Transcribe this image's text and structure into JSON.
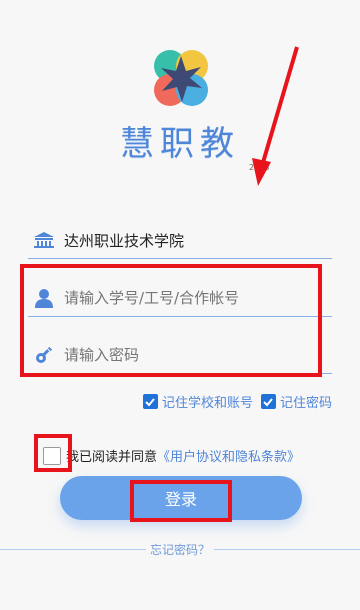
{
  "app": {
    "title": "慧职教",
    "version": "2.0.8"
  },
  "form": {
    "school_name": "达州职业技术学院",
    "username_placeholder": "请输入学号/工号/合作帐号",
    "password_placeholder": "请输入密码"
  },
  "options": {
    "remember_school_label": "记住学校和账号",
    "remember_school_checked": true,
    "remember_password_label": "记住密码",
    "remember_password_checked": true
  },
  "agreement": {
    "text": "我已阅读并同意",
    "link": "《用户协议和隐私条款》",
    "checked": false
  },
  "buttons": {
    "login_label": "登录",
    "forgot_label": "忘记密码？"
  },
  "colors": {
    "accent": "#4f86d8",
    "button": "#6aa3ea",
    "checkbox": "#1e72d8",
    "highlight_red": "#e8141c"
  },
  "icons": {
    "school": "school-building-icon",
    "user": "user-icon",
    "password": "key-icon",
    "checkbox": "checkmark-icon"
  }
}
